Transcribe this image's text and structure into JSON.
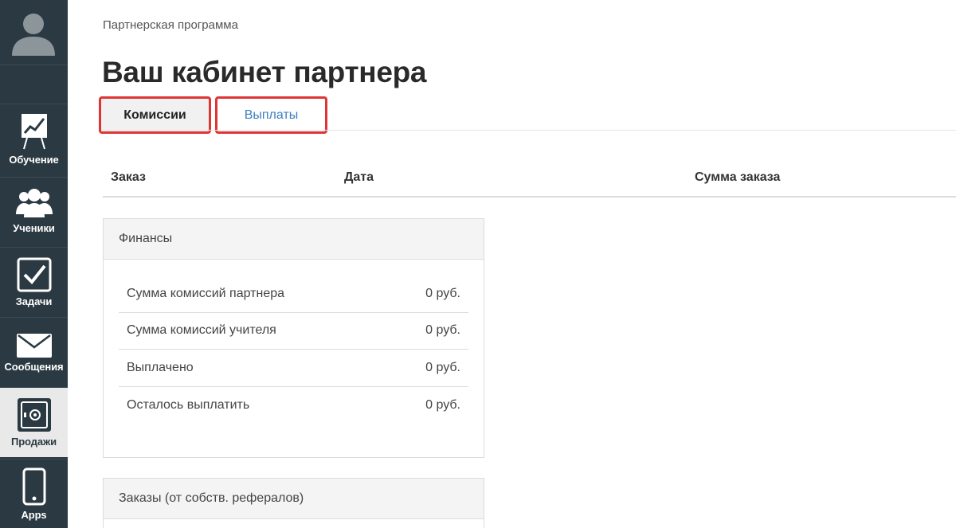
{
  "sidebar": {
    "items": [
      {
        "label": "Обучение",
        "icon": "chart-board-icon"
      },
      {
        "label": "Ученики",
        "icon": "users-icon"
      },
      {
        "label": "Задачи",
        "icon": "checkbox-icon"
      },
      {
        "label": "Сообщения",
        "icon": "envelope-icon"
      },
      {
        "label": "Продажи",
        "icon": "safe-icon",
        "active": true
      },
      {
        "label": "Apps",
        "icon": "phone-icon"
      }
    ]
  },
  "breadcrumb": "Партнерская программа",
  "title": "Ваш кабинет партнера",
  "tabs": [
    {
      "label": "Комиссии",
      "active": true
    },
    {
      "label": "Выплаты",
      "active": false
    }
  ],
  "table": {
    "columns": [
      "Заказ",
      "Дата",
      "Сумма заказа"
    ]
  },
  "finance": {
    "title": "Финансы",
    "rows": [
      {
        "label": "Сумма комиссий партнера",
        "value": "0 руб."
      },
      {
        "label": "Сумма комиссий учителя",
        "value": "0 руб."
      },
      {
        "label": "Выплачено",
        "value": "0 руб."
      },
      {
        "label": "Осталось выплатить",
        "value": "0 руб."
      }
    ]
  },
  "orders_panel": {
    "title": "Заказы (от собств. рефералов)"
  },
  "colors": {
    "sidebar_bg": "#2b3a42",
    "highlight": "#e03535",
    "link": "#3b7fc0"
  }
}
